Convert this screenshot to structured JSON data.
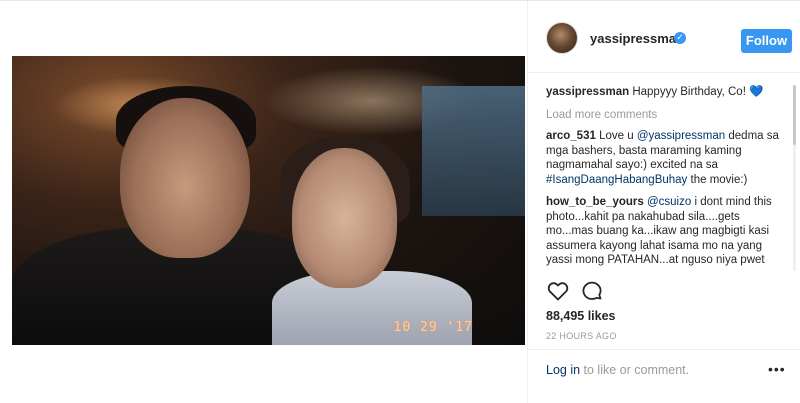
{
  "post": {
    "photo": {
      "date_stamp": "10 29 '17"
    },
    "header": {
      "username": "yassipressman",
      "verified_icon": "verified-check-icon",
      "follow_label": "Follow"
    },
    "caption": {
      "username": "yassipressman",
      "text": "Happyyy Birthday, Co!",
      "emoji": "💙"
    },
    "load_more_label": "Load more comments",
    "comments": [
      {
        "username": "arco_531",
        "pre": "Love u ",
        "mention": "@yassipressman",
        "mid": " dedma sa mga bashers, basta maraming kaming nagmamahal sayo:) excited na sa ",
        "hashtag": "#IsangDaangHabangBuhay",
        "post": " the movie:)"
      },
      {
        "username": "how_to_be_yours",
        "pre": "",
        "mention": "@csuizo",
        "mid": " i dont mind this photo...kahit pa nakahubad sila....gets mo...mas buang ka...ikaw ang magbigti kasi assumera kayong lahat isama mo na yang yassi mong PATAHAN...at nguso niya pwet",
        "hashtag": "",
        "post": ""
      }
    ],
    "actions": {
      "like_icon": "heart-outline-icon",
      "comment_icon": "comment-bubble-icon"
    },
    "likes_text": "88,495 likes",
    "timestamp": "22 HOURS AGO",
    "login": {
      "link": "Log in",
      "rest": " to like or comment."
    },
    "more_icon": "more-options-icon",
    "more_glyph": "•••",
    "colors": {
      "accent": "#3897f0",
      "link": "#003569",
      "muted": "#999999",
      "text": "#262626"
    }
  }
}
